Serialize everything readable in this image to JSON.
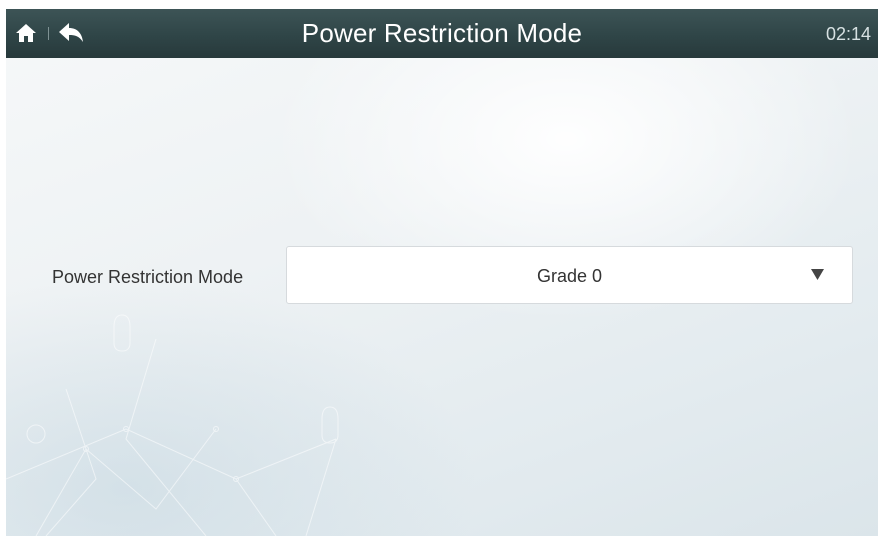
{
  "header": {
    "title": "Power Restriction Mode",
    "clock": "02:14",
    "home_icon": "home-icon",
    "back_icon": "back-arrow-icon",
    "background_color": "#2f4547"
  },
  "form": {
    "field_label": "Power Restriction Mode",
    "selected_value": "Grade 0",
    "dropdown_icon": "triangle-down-icon"
  }
}
